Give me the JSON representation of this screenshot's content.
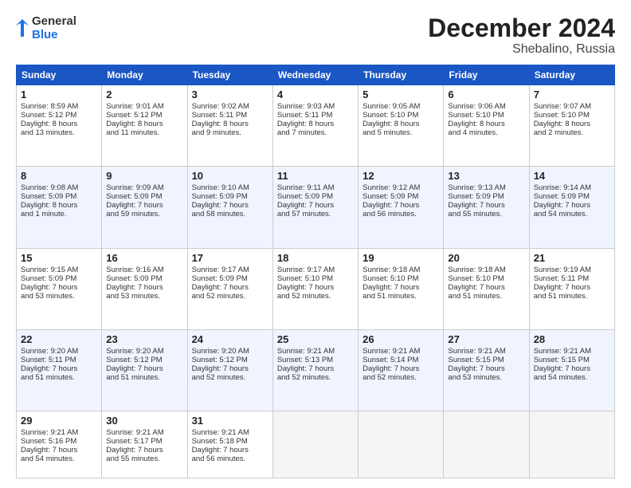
{
  "logo": {
    "line1": "General",
    "line2": "Blue"
  },
  "title": {
    "month_year": "December 2024",
    "location": "Shebalino, Russia"
  },
  "headers": [
    "Sunday",
    "Monday",
    "Tuesday",
    "Wednesday",
    "Thursday",
    "Friday",
    "Saturday"
  ],
  "weeks": [
    [
      {
        "day": "1",
        "lines": [
          "Sunrise: 8:59 AM",
          "Sunset: 5:12 PM",
          "Daylight: 8 hours",
          "and 13 minutes."
        ]
      },
      {
        "day": "2",
        "lines": [
          "Sunrise: 9:01 AM",
          "Sunset: 5:12 PM",
          "Daylight: 8 hours",
          "and 11 minutes."
        ]
      },
      {
        "day": "3",
        "lines": [
          "Sunrise: 9:02 AM",
          "Sunset: 5:11 PM",
          "Daylight: 8 hours",
          "and 9 minutes."
        ]
      },
      {
        "day": "4",
        "lines": [
          "Sunrise: 9:03 AM",
          "Sunset: 5:11 PM",
          "Daylight: 8 hours",
          "and 7 minutes."
        ]
      },
      {
        "day": "5",
        "lines": [
          "Sunrise: 9:05 AM",
          "Sunset: 5:10 PM",
          "Daylight: 8 hours",
          "and 5 minutes."
        ]
      },
      {
        "day": "6",
        "lines": [
          "Sunrise: 9:06 AM",
          "Sunset: 5:10 PM",
          "Daylight: 8 hours",
          "and 4 minutes."
        ]
      },
      {
        "day": "7",
        "lines": [
          "Sunrise: 9:07 AM",
          "Sunset: 5:10 PM",
          "Daylight: 8 hours",
          "and 2 minutes."
        ]
      }
    ],
    [
      {
        "day": "8",
        "lines": [
          "Sunrise: 9:08 AM",
          "Sunset: 5:09 PM",
          "Daylight: 8 hours",
          "and 1 minute."
        ]
      },
      {
        "day": "9",
        "lines": [
          "Sunrise: 9:09 AM",
          "Sunset: 5:09 PM",
          "Daylight: 7 hours",
          "and 59 minutes."
        ]
      },
      {
        "day": "10",
        "lines": [
          "Sunrise: 9:10 AM",
          "Sunset: 5:09 PM",
          "Daylight: 7 hours",
          "and 58 minutes."
        ]
      },
      {
        "day": "11",
        "lines": [
          "Sunrise: 9:11 AM",
          "Sunset: 5:09 PM",
          "Daylight: 7 hours",
          "and 57 minutes."
        ]
      },
      {
        "day": "12",
        "lines": [
          "Sunrise: 9:12 AM",
          "Sunset: 5:09 PM",
          "Daylight: 7 hours",
          "and 56 minutes."
        ]
      },
      {
        "day": "13",
        "lines": [
          "Sunrise: 9:13 AM",
          "Sunset: 5:09 PM",
          "Daylight: 7 hours",
          "and 55 minutes."
        ]
      },
      {
        "day": "14",
        "lines": [
          "Sunrise: 9:14 AM",
          "Sunset: 5:09 PM",
          "Daylight: 7 hours",
          "and 54 minutes."
        ]
      }
    ],
    [
      {
        "day": "15",
        "lines": [
          "Sunrise: 9:15 AM",
          "Sunset: 5:09 PM",
          "Daylight: 7 hours",
          "and 53 minutes."
        ]
      },
      {
        "day": "16",
        "lines": [
          "Sunrise: 9:16 AM",
          "Sunset: 5:09 PM",
          "Daylight: 7 hours",
          "and 53 minutes."
        ]
      },
      {
        "day": "17",
        "lines": [
          "Sunrise: 9:17 AM",
          "Sunset: 5:09 PM",
          "Daylight: 7 hours",
          "and 52 minutes."
        ]
      },
      {
        "day": "18",
        "lines": [
          "Sunrise: 9:17 AM",
          "Sunset: 5:10 PM",
          "Daylight: 7 hours",
          "and 52 minutes."
        ]
      },
      {
        "day": "19",
        "lines": [
          "Sunrise: 9:18 AM",
          "Sunset: 5:10 PM",
          "Daylight: 7 hours",
          "and 51 minutes."
        ]
      },
      {
        "day": "20",
        "lines": [
          "Sunrise: 9:18 AM",
          "Sunset: 5:10 PM",
          "Daylight: 7 hours",
          "and 51 minutes."
        ]
      },
      {
        "day": "21",
        "lines": [
          "Sunrise: 9:19 AM",
          "Sunset: 5:11 PM",
          "Daylight: 7 hours",
          "and 51 minutes."
        ]
      }
    ],
    [
      {
        "day": "22",
        "lines": [
          "Sunrise: 9:20 AM",
          "Sunset: 5:11 PM",
          "Daylight: 7 hours",
          "and 51 minutes."
        ]
      },
      {
        "day": "23",
        "lines": [
          "Sunrise: 9:20 AM",
          "Sunset: 5:12 PM",
          "Daylight: 7 hours",
          "and 51 minutes."
        ]
      },
      {
        "day": "24",
        "lines": [
          "Sunrise: 9:20 AM",
          "Sunset: 5:12 PM",
          "Daylight: 7 hours",
          "and 52 minutes."
        ]
      },
      {
        "day": "25",
        "lines": [
          "Sunrise: 9:21 AM",
          "Sunset: 5:13 PM",
          "Daylight: 7 hours",
          "and 52 minutes."
        ]
      },
      {
        "day": "26",
        "lines": [
          "Sunrise: 9:21 AM",
          "Sunset: 5:14 PM",
          "Daylight: 7 hours",
          "and 52 minutes."
        ]
      },
      {
        "day": "27",
        "lines": [
          "Sunrise: 9:21 AM",
          "Sunset: 5:15 PM",
          "Daylight: 7 hours",
          "and 53 minutes."
        ]
      },
      {
        "day": "28",
        "lines": [
          "Sunrise: 9:21 AM",
          "Sunset: 5:15 PM",
          "Daylight: 7 hours",
          "and 54 minutes."
        ]
      }
    ],
    [
      {
        "day": "29",
        "lines": [
          "Sunrise: 9:21 AM",
          "Sunset: 5:16 PM",
          "Daylight: 7 hours",
          "and 54 minutes."
        ]
      },
      {
        "day": "30",
        "lines": [
          "Sunrise: 9:21 AM",
          "Sunset: 5:17 PM",
          "Daylight: 7 hours",
          "and 55 minutes."
        ]
      },
      {
        "day": "31",
        "lines": [
          "Sunrise: 9:21 AM",
          "Sunset: 5:18 PM",
          "Daylight: 7 hours",
          "and 56 minutes."
        ]
      },
      null,
      null,
      null,
      null
    ]
  ]
}
